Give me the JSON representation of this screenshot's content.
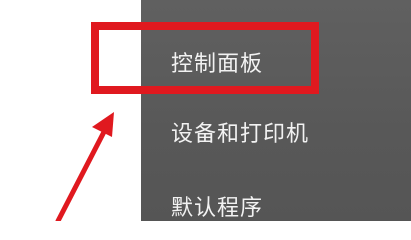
{
  "menu": {
    "items": [
      {
        "label": "控制面板",
        "highlighted": true
      },
      {
        "label": "设备和打印机",
        "highlighted": false
      },
      {
        "label": "默认程序",
        "highlighted": false
      }
    ]
  },
  "annotation": {
    "color": "#e0191f",
    "shape": "rectangle",
    "pointer": "arrow-icon"
  },
  "colors": {
    "menu_background": "#5b5b5b",
    "menu_text": "#f2f2f2",
    "page_background": "#ffffff"
  }
}
